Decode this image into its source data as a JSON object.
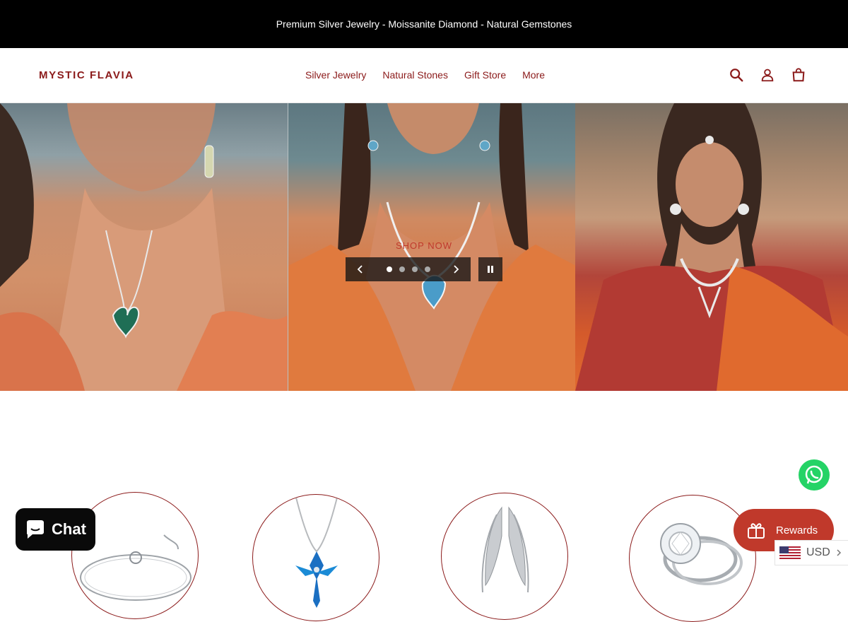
{
  "announcement": {
    "text": "Premium Silver Jewelry - Moissanite Diamond - Natural Gemstones"
  },
  "header": {
    "logo": "MYSTIC FLAVIA",
    "nav": [
      "Silver Jewelry",
      "Natural Stones",
      "Gift Store",
      "More"
    ],
    "icons": [
      "search-icon",
      "account-icon",
      "cart-icon"
    ]
  },
  "hero": {
    "cta": "SHOP NOW",
    "slides_total": 4,
    "active_slide": 1
  },
  "categories": {
    "items": [
      {
        "icon": "bracelet-image"
      },
      {
        "icon": "blue-pendant-necklace-image"
      },
      {
        "icon": "wing-earrings-image"
      },
      {
        "icon": "diamond-ring-image"
      }
    ]
  },
  "widgets": {
    "chat_label": "Chat",
    "rewards_label": "Rewards",
    "currency": "USD"
  },
  "colors": {
    "brand": "#8b1a1a",
    "announcement_bg": "#000000",
    "rewards_bg": "#c0392b",
    "whatsapp": "#25d366"
  }
}
